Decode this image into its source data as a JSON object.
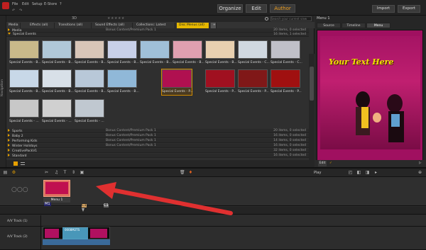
{
  "menubar": [
    "File",
    "Edit",
    "Setup",
    "E-Store"
  ],
  "modes": [
    "Organize",
    "Edit",
    "Author"
  ],
  "active_mode": "Author",
  "import_label": "Import",
  "export_label": "Export",
  "library": {
    "nav_label": "Navigation",
    "view_3d": "3D",
    "search_placeholder": "Search your current view",
    "tabs": [
      "Media",
      "Effects (all)",
      "Transitions (all)",
      "Sound Effects (all)",
      "Collections: Latest Import",
      "Disc Menus (all)"
    ],
    "active_tab": "Disc Menus (all)",
    "top_groups": [
      {
        "name": "Media",
        "pack": "Bonus Content/Premium Pack 1",
        "count": "20 items, 0 selected"
      },
      {
        "name": "Special Events",
        "pack": "",
        "count": "16 items, 1 selected"
      }
    ],
    "thumbs_row1": [
      "Special Events - B...",
      "Special Events - B...",
      "Special Events - B...",
      "Special Events - B...",
      "Special Events - B...",
      "Special Events - B...",
      "Special Events - B...",
      "Special Events - C...",
      "Special Events - C..."
    ],
    "thumbs_row2": [
      "Special Events - B...",
      "Special Events - B...",
      "Special Events - B...",
      "Special Events - B...",
      "Special Events - P...",
      "Special Events - P...",
      "Special Events - P...",
      "Special Events - P..."
    ],
    "thumbs_row3": [
      "Special Events - ...",
      "Special Events - ...",
      "Special Events - ..."
    ],
    "bottom_groups": [
      {
        "name": "Sports",
        "pack": "Bonus Content/Premium Pack 1",
        "count": "20 items, 0 selected"
      },
      {
        "name": "Baby 2",
        "pack": "Bonus Content/Premium Pack 1",
        "count": "16 items, 0 selected"
      },
      {
        "name": "Performing Kids",
        "pack": "Bonus Content/Premium Pack 1",
        "count": "14 items, 0 selected"
      },
      {
        "name": "Winter Holidays",
        "pack": "Bonus Content/Premium Pack 1",
        "count": "16 items, 0 selected"
      },
      {
        "name": "CreativePackV1",
        "pack": "",
        "count": "32 items, 0 selected"
      },
      {
        "name": "Standard",
        "pack": "",
        "count": "16 items, 0 selected"
      }
    ]
  },
  "preview": {
    "title": "Menu 1",
    "tabs": [
      "Source",
      "Timeline",
      "Menu"
    ],
    "active_tab": "Menu",
    "overlay_text": "Your Text Here",
    "edit_label": "Edit",
    "play_label": "Play"
  },
  "timeline": {
    "menu_label": "Menu 1",
    "tracks": [
      "A/V Track (1)",
      "A/V Track (2)"
    ],
    "clip_label": "0008M2TS",
    "marker_m1": "M1",
    "marker_c1": "C1",
    "marker_c2": "C1"
  },
  "colors": {
    "accent": "#f0a020",
    "arrow": "#e03030",
    "menu_bg": "#a51464",
    "title_text": "#f1e400"
  }
}
